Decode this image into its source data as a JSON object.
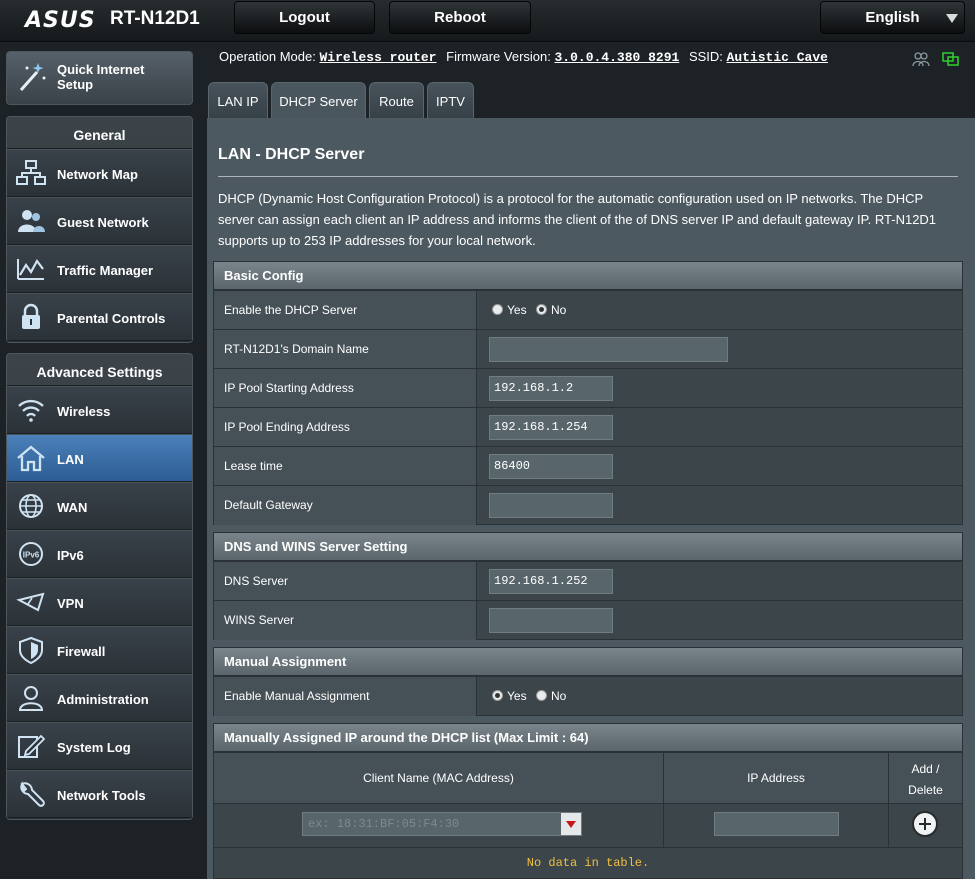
{
  "header": {
    "brand": "ASUS",
    "model": "RT-N12D1",
    "logout_label": "Logout",
    "reboot_label": "Reboot",
    "language": "English"
  },
  "status": {
    "operation_mode_label": "Operation Mode:",
    "operation_mode": "Wireless router",
    "firmware_label": "Firmware Version:",
    "firmware": "3.0.0.4.380_8291",
    "ssid_label": "SSID:",
    "ssid": "Autistic Cave"
  },
  "sidebar": {
    "qis_label_1": "Quick Internet",
    "qis_label_2": "Setup",
    "general_title": "General",
    "general_items": [
      {
        "label": "Network Map",
        "icon": "network-map-icon"
      },
      {
        "label": "Guest Network",
        "icon": "guest-network-icon"
      },
      {
        "label": "Traffic Manager",
        "icon": "traffic-manager-icon"
      },
      {
        "label": "Parental Controls",
        "icon": "lock-icon"
      }
    ],
    "advanced_title": "Advanced Settings",
    "advanced_items": [
      {
        "label": "Wireless",
        "icon": "wifi-icon"
      },
      {
        "label": "LAN",
        "icon": "home-icon",
        "active": true
      },
      {
        "label": "WAN",
        "icon": "globe-icon"
      },
      {
        "label": "IPv6",
        "icon": "ipv6-icon"
      },
      {
        "label": "VPN",
        "icon": "vpn-icon"
      },
      {
        "label": "Firewall",
        "icon": "shield-icon"
      },
      {
        "label": "Administration",
        "icon": "user-icon"
      },
      {
        "label": "System Log",
        "icon": "edit-icon"
      },
      {
        "label": "Network Tools",
        "icon": "wrench-icon"
      }
    ]
  },
  "tabs": [
    {
      "label": "LAN IP"
    },
    {
      "label": "DHCP Server",
      "active": true
    },
    {
      "label": "Route"
    },
    {
      "label": "IPTV"
    }
  ],
  "page": {
    "title": "LAN - DHCP Server",
    "description": "DHCP (Dynamic Host Configuration Protocol) is a protocol for the automatic configuration used on IP networks. The DHCP server can assign each client an IP address and informs the client of the of DNS server IP and default gateway IP. RT-N12D1 supports up to 253 IP addresses for your local network."
  },
  "basic_config": {
    "title": "Basic Config",
    "enable_label": "Enable the DHCP Server",
    "yes": "Yes",
    "no": "No",
    "enable_value": "No",
    "domain_label": "RT-N12D1's Domain Name",
    "domain_value": "",
    "pool_start_label": "IP Pool Starting Address",
    "pool_start_value": "192.168.1.2",
    "pool_end_label": "IP Pool Ending Address",
    "pool_end_value": "192.168.1.254",
    "lease_label": "Lease time",
    "lease_value": "86400",
    "gateway_label": "Default Gateway",
    "gateway_value": ""
  },
  "dns_wins": {
    "title": "DNS and WINS Server Setting",
    "dns_label": "DNS Server",
    "dns_value": "192.168.1.252",
    "wins_label": "WINS Server",
    "wins_value": ""
  },
  "manual": {
    "title": "Manual Assignment",
    "enable_label": "Enable Manual Assignment",
    "yes": "Yes",
    "no": "No",
    "enable_value": "Yes"
  },
  "manual_list": {
    "title": "Manually Assigned IP around the DHCP list (Max Limit : 64)",
    "col_client": "Client Name (MAC Address)",
    "col_ip": "IP Address",
    "col_add_1": "Add /",
    "col_add_2": "Delete",
    "client_placeholder": "ex: 18:31:BF:05:F4:30",
    "empty_text": "No data in table."
  }
}
